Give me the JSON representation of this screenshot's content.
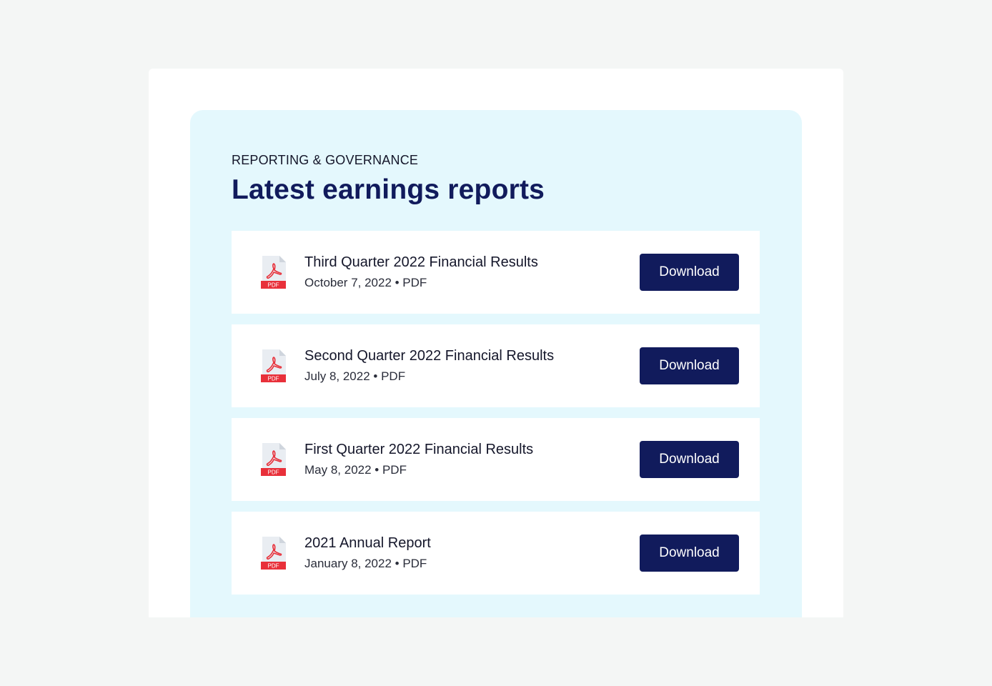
{
  "section": {
    "eyebrow": "REPORTING & GOVERNANCE",
    "title": "Latest earnings reports"
  },
  "reports": [
    {
      "title": "Third Quarter 2022 Financial Results",
      "meta": "October 7, 2022 • PDF",
      "icon": "pdf-file-icon",
      "icon_label": "PDF",
      "button": "Download"
    },
    {
      "title": "Second Quarter 2022 Financial Results",
      "meta": "July 8, 2022 • PDF",
      "icon": "pdf-file-icon",
      "icon_label": "PDF",
      "button": "Download"
    },
    {
      "title": "First Quarter 2022 Financial Results",
      "meta": "May 8, 2022 • PDF",
      "icon": "pdf-file-icon",
      "icon_label": "PDF",
      "button": "Download"
    },
    {
      "title": "2021 Annual Report",
      "meta": "January 8, 2022 • PDF",
      "icon": "pdf-file-icon",
      "icon_label": "PDF",
      "button": "Download"
    }
  ],
  "colors": {
    "page_bg": "#f4f6f5",
    "panel_bg": "#e4f8fd",
    "brand_navy": "#111b5c",
    "pdf_red": "#e8303a"
  }
}
